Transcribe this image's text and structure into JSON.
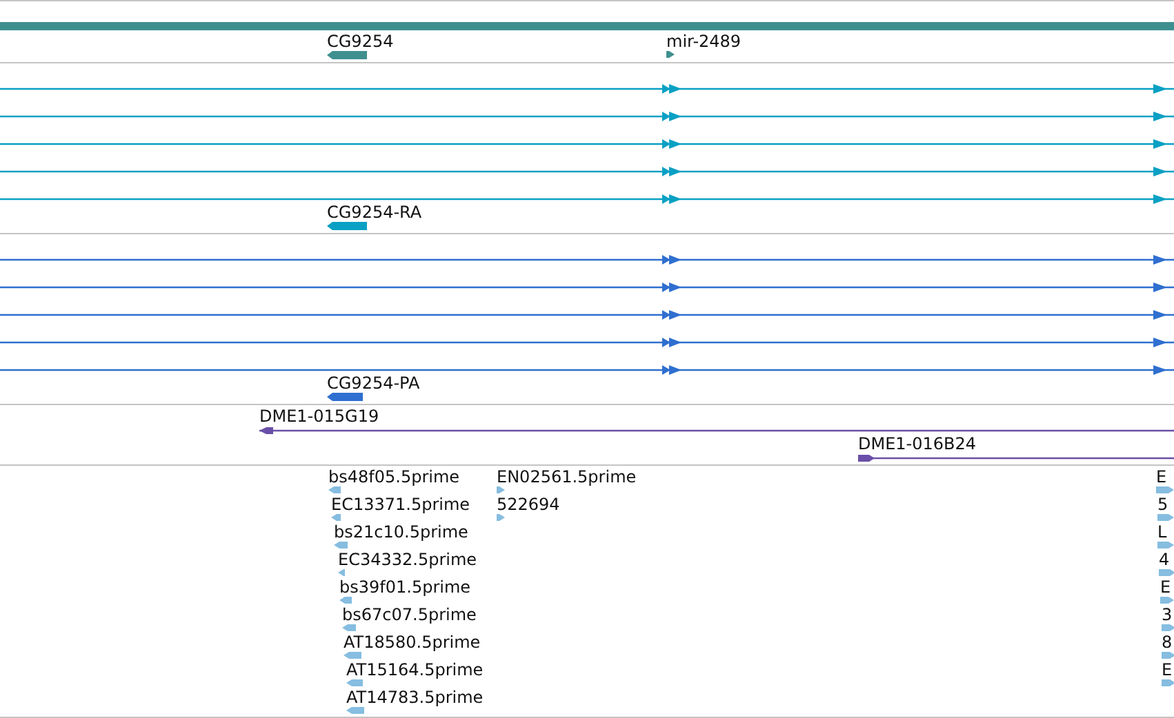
{
  "genes": [
    {
      "label": "CG9254",
      "reverse": true
    },
    {
      "label": "mir-2489",
      "reverse": false
    }
  ],
  "transcript_tracks": [
    {
      "color": "#0aa0c4",
      "feature": {
        "label": "CG9254-RA",
        "reverse": true
      }
    },
    {
      "color": "#2f6fd0",
      "feature": {
        "label": "CG9254-PA",
        "reverse": true
      }
    }
  ],
  "clones": [
    {
      "label": "DME1-015G19",
      "reverse": true
    },
    {
      "label": "DME1-016B24",
      "reverse": false
    }
  ],
  "ests": [
    {
      "label": "bs48f05.5prime",
      "reverse": true
    },
    {
      "label": "EC13371.5prime",
      "reverse": true
    },
    {
      "label": "bs21c10.5prime",
      "reverse": true
    },
    {
      "label": "EC34332.5prime",
      "reverse": true
    },
    {
      "label": "bs39f01.5prime",
      "reverse": true
    },
    {
      "label": "bs67c07.5prime",
      "reverse": true
    },
    {
      "label": "AT18580.5prime",
      "reverse": true
    },
    {
      "label": "AT15164.5prime",
      "reverse": true
    },
    {
      "label": "AT14783.5prime",
      "reverse": true
    },
    {
      "label": "EN02561.5prime",
      "reverse": false
    },
    {
      "label": "522694",
      "reverse": false
    },
    {
      "label": "E",
      "reverse": false
    },
    {
      "label": "5",
      "reverse": false
    },
    {
      "label": "L",
      "reverse": false
    },
    {
      "label": "4",
      "reverse": false
    },
    {
      "label": "E",
      "reverse": false
    },
    {
      "label": "3",
      "reverse": false
    },
    {
      "label": "8",
      "reverse": false
    },
    {
      "label": "E",
      "reverse": false
    }
  ]
}
